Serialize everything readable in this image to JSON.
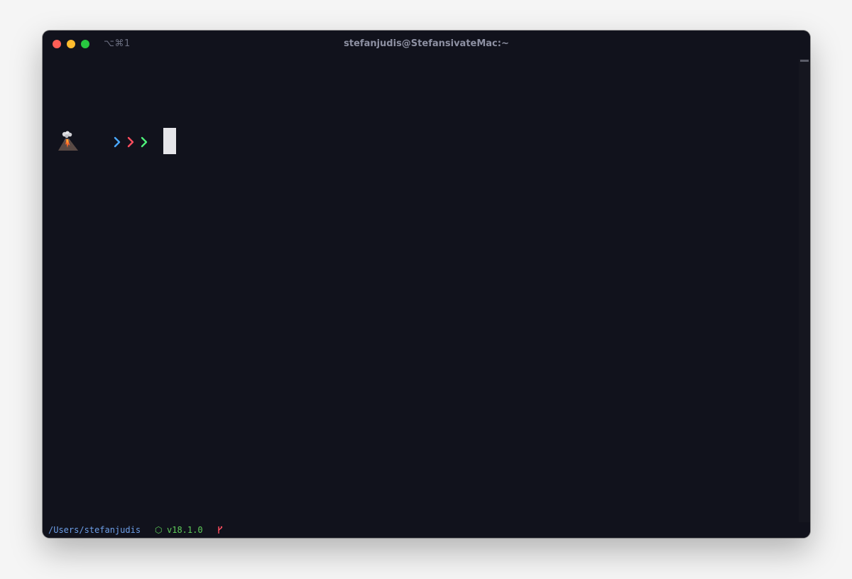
{
  "window": {
    "title": "stefanjudis@StefansivateMac:~",
    "shortcut": "⌥⌘1"
  },
  "terminal": {
    "prompt_icon": "volcano-icon",
    "prompt_chevrons": [
      {
        "icon": "chevron-right-icon",
        "color": "#4aa8ff"
      },
      {
        "icon": "chevron-right-icon",
        "color": "#ff4d5e"
      },
      {
        "icon": "chevron-right-icon",
        "color": "#4ef07a"
      }
    ],
    "cursor_color": "#e6e6ea"
  },
  "status_bar": {
    "path": "/Users/stefanjudis",
    "node_icon": "⬡",
    "node_version": "v18.1.0",
    "git_icon": "git-branch-icon",
    "path_color": "#6d9fe8",
    "node_color": "#5fcc5a",
    "git_color": "#ff4d5e"
  },
  "colors": {
    "background": "#11121c",
    "close": "#ff5f57",
    "minimize": "#febc2e",
    "zoom": "#28c840"
  }
}
